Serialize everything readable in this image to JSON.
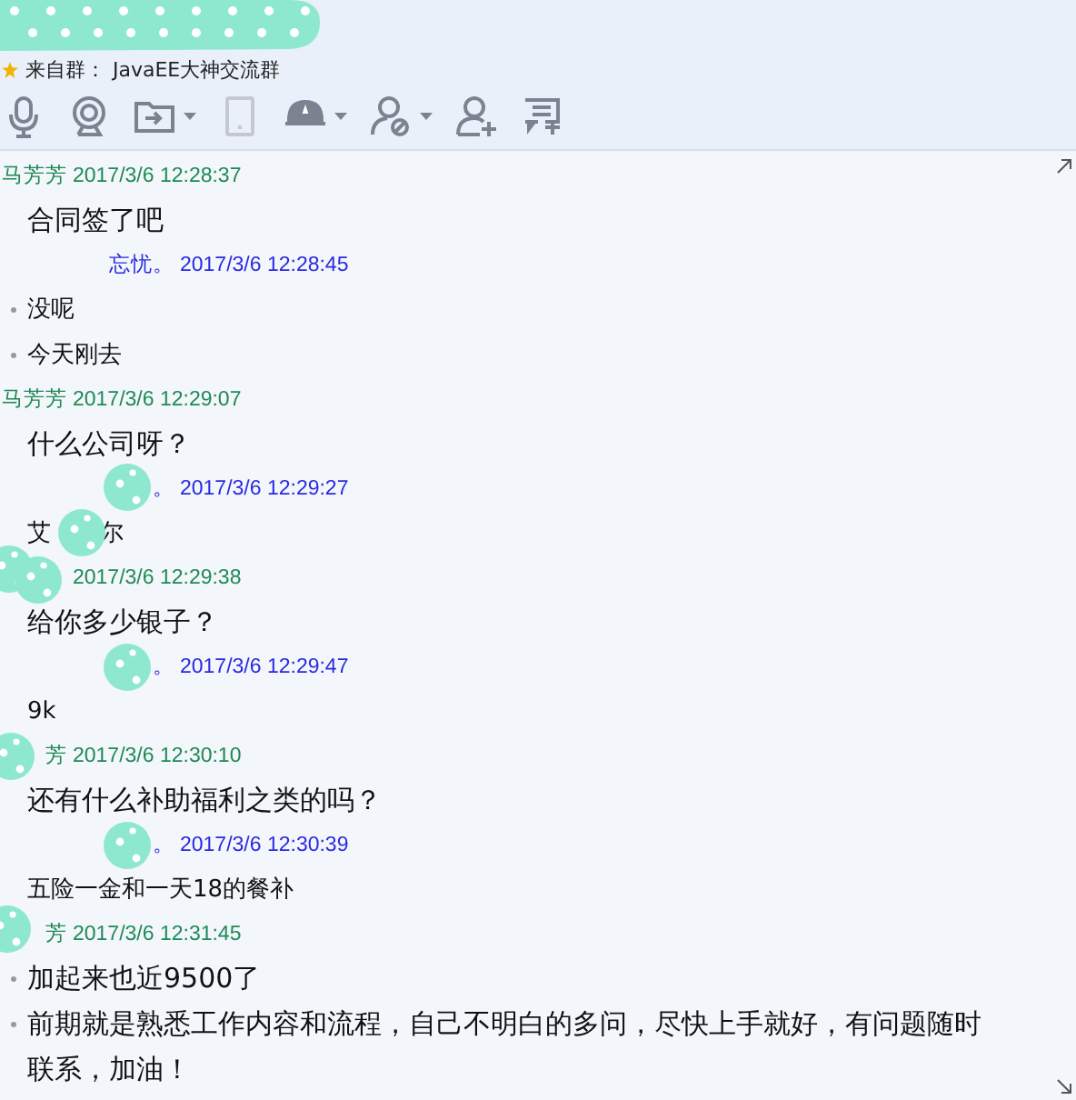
{
  "group_line": {
    "label": "来自群：",
    "group": "JavaEE大神交流群"
  },
  "toolbar": [
    {
      "kind": "mic",
      "caret": false,
      "disabled": false
    },
    {
      "kind": "camera",
      "caret": false,
      "disabled": false
    },
    {
      "kind": "folder",
      "caret": true,
      "disabled": false
    },
    {
      "kind": "tablet",
      "caret": false,
      "disabled": true
    },
    {
      "kind": "hat",
      "caret": true,
      "disabled": false
    },
    {
      "kind": "person-block",
      "caret": true,
      "disabled": false
    },
    {
      "kind": "person-add",
      "caret": false,
      "disabled": false
    },
    {
      "kind": "message-add",
      "caret": false,
      "disabled": false
    }
  ],
  "messages": [
    {
      "self": false,
      "sender": "马芳芳",
      "time": "2017/3/6 12:28:37",
      "lines": [
        {
          "text": "合同签了吧",
          "bullet": false
        }
      ]
    },
    {
      "self": true,
      "sender": "忘忧。",
      "time": "2017/3/6 12:28:45",
      "lines": [
        {
          "text": "没呢",
          "bullet": true
        },
        {
          "text": "今天刚去",
          "bullet": true
        }
      ]
    },
    {
      "self": false,
      "sender": "马芳芳",
      "time": "2017/3/6 12:29:07",
      "lines": [
        {
          "text": "什么公司呀？",
          "bullet": false
        }
      ]
    },
    {
      "self": true,
      "sender": "。",
      "time": "2017/3/6 12:29:27",
      "lines": [
        {
          "segments": [
            "艾",
            "尔"
          ],
          "bullet": false
        }
      ]
    },
    {
      "self": false,
      "time": "2017/3/6 12:29:38",
      "lines": [
        {
          "text": "给你多少银子？",
          "bullet": false
        }
      ]
    },
    {
      "self": true,
      "sender": "。",
      "time": "2017/3/6 12:29:47",
      "lines": [
        {
          "text": "9k",
          "bullet": false
        }
      ]
    },
    {
      "self": false,
      "sender": "芳",
      "time": "2017/3/6 12:30:10",
      "lines": [
        {
          "text": "还有什么补助福利之类的吗？",
          "bullet": false
        }
      ]
    },
    {
      "self": true,
      "sender": "。",
      "time": "2017/3/6 12:30:39",
      "lines": [
        {
          "text": "五险一金和一天18的餐补",
          "bullet": false
        }
      ]
    },
    {
      "self": false,
      "sender": "芳",
      "time": "2017/3/6 12:31:45",
      "lines": [
        {
          "text": "加起来也近9500了",
          "bullet": true
        },
        {
          "text": "前期就是熟悉工作内容和流程，自己不明白的多问，尽快上手就好，有问题随时联系，加油！",
          "bullet": true
        }
      ]
    }
  ]
}
